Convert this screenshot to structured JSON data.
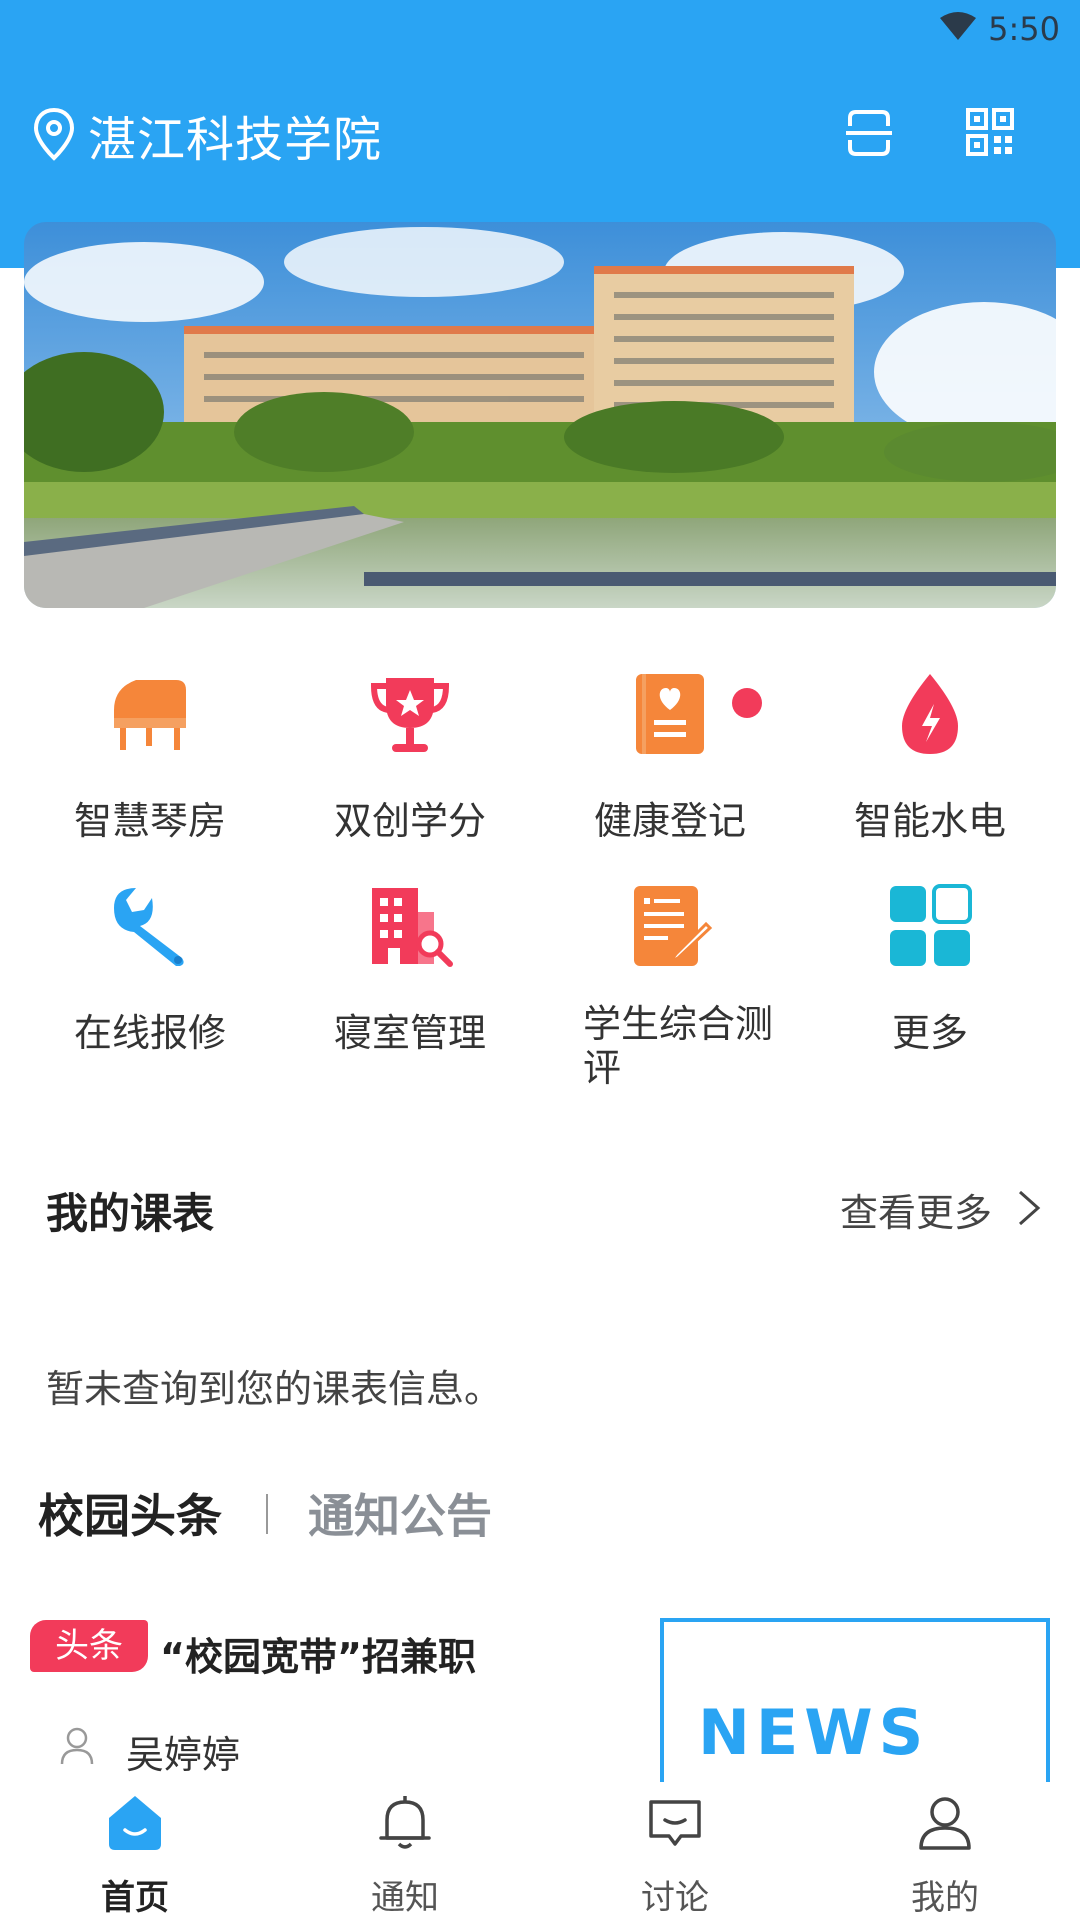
{
  "status_bar": {
    "time": "5:50"
  },
  "header": {
    "school_name": "湛江科技学院"
  },
  "banner": {
    "alt": ""
  },
  "grid": [
    {
      "label": "智慧琴房",
      "icon": "piano-icon"
    },
    {
      "label": "双创学分",
      "icon": "trophy-icon"
    },
    {
      "label": "健康登记",
      "icon": "health-book-icon"
    },
    {
      "label": "智能水电",
      "icon": "water-drop-icon"
    },
    {
      "label": "在线报修",
      "icon": "wrench-icon"
    },
    {
      "label": "寝室管理",
      "icon": "building-search-icon"
    },
    {
      "label": "学生综合测评",
      "icon": "document-edit-icon"
    },
    {
      "label": "更多",
      "icon": "grid-more-icon"
    }
  ],
  "schedule": {
    "title": "我的课表",
    "more": "查看更多",
    "empty": "暂未查询到您的课表信息。"
  },
  "news": {
    "tabs": [
      "校园头条",
      "通知公告"
    ],
    "item": {
      "tag": "头条",
      "title": "“校园宽带”招兼职",
      "author": "吴婷婷",
      "thumb_text": "NEWS"
    }
  },
  "tabbar": [
    {
      "label": "首页",
      "icon": "home-icon"
    },
    {
      "label": "通知",
      "icon": "bell-icon"
    },
    {
      "label": "讨论",
      "icon": "chat-icon"
    },
    {
      "label": "我的",
      "icon": "user-icon"
    }
  ],
  "colors": {
    "primary": "#2aa4f3",
    "orange": "#f5863a",
    "red": "#f23b5a",
    "cyan": "#1ab7d6"
  }
}
